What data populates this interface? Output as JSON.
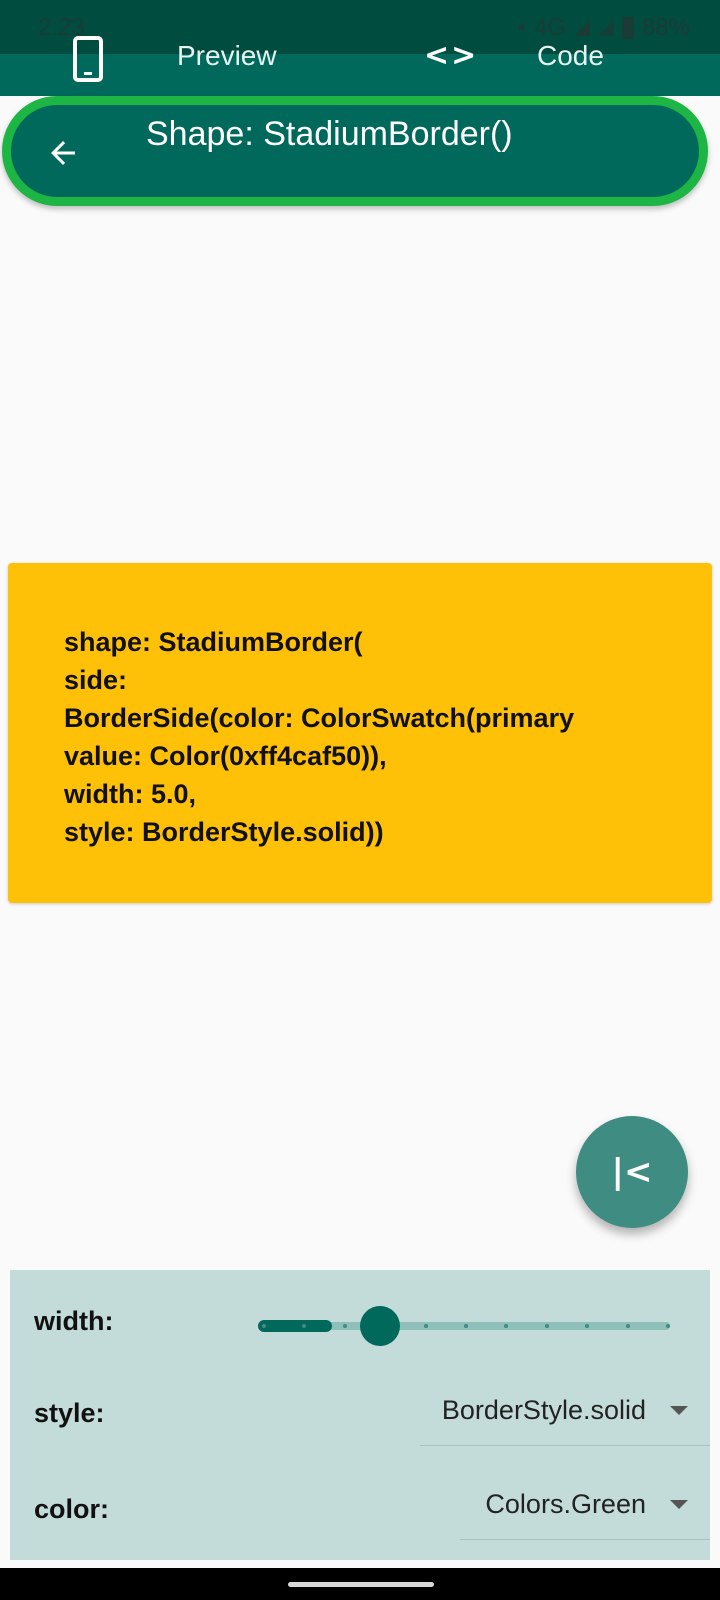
{
  "status": {
    "time": "2:23",
    "network": "4G",
    "battery": "88%"
  },
  "tabs": [
    {
      "label": "Preview",
      "icon": "phone-icon"
    },
    {
      "label": "Code",
      "icon": "code-icon"
    }
  ],
  "appbar": {
    "title": "Shape: StadiumBorder()",
    "back_icon": "arrow-back-icon",
    "border_color": "#1db544",
    "background": "#00695c"
  },
  "code_card": {
    "text": "shape: StadiumBorder(\nside:\nBorderSide(color: ColorSwatch(primary\nvalue: Color(0xff4caf50)),\nwidth: 5.0,\nstyle: BorderStyle.solid))",
    "background": "#ffc107"
  },
  "fab": {
    "icon": "first-page-icon",
    "glyph": "|<"
  },
  "controls": {
    "width": {
      "label": "width:",
      "value_fraction": 0.17,
      "ticks": 11
    },
    "style": {
      "label": "style:",
      "value": "BorderStyle.solid"
    },
    "color": {
      "label": "color:",
      "value": "Colors.Green"
    }
  }
}
